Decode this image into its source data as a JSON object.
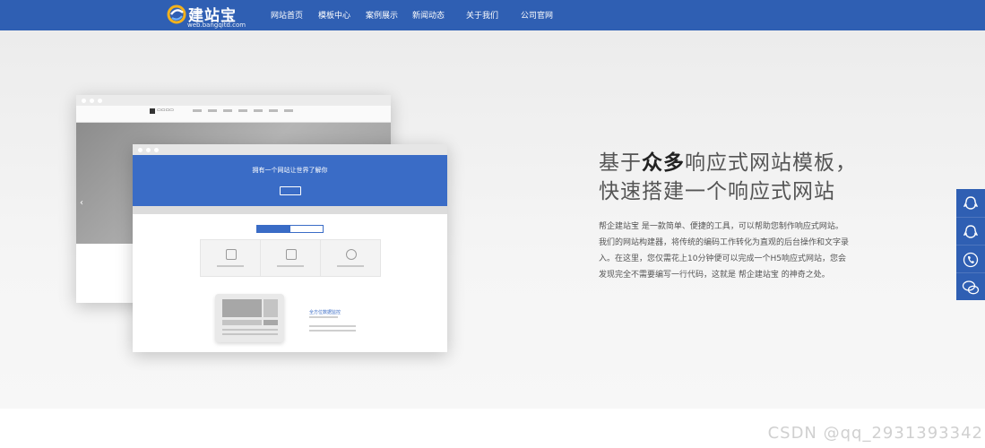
{
  "header": {
    "logo_title": "建站宝",
    "logo_subtitle": "web.bangqitd.com",
    "nav": [
      {
        "label": "网站首页"
      },
      {
        "label": "模板中心"
      },
      {
        "label": "案例展示"
      },
      {
        "label": "新闻动态"
      },
      {
        "label": "关于我们"
      },
      {
        "label": "公司官网"
      }
    ]
  },
  "hero": {
    "headline_line1_pre": "基于",
    "headline_line1_bold": "众多",
    "headline_line1_post": "响应式网站模板，",
    "headline_line2": "快速搭建一个响应式网站",
    "description_lines": [
      "帮企建站宝 是一款简单、便捷的工具，可以帮助您制作响应式网站。",
      "我们的网站构建器，将传统的编码工作转化为直观的后台操作和文字录",
      "入。在这里，您仅需花上10分钟便可以完成一个H5响应式网站，您会",
      "发现完全不需要编写一行代码，这就是 帮企建站宝 的神奇之处。"
    ]
  },
  "mockup": {
    "front_title": "拥有一个网站让世界了解你",
    "feature_title": "全方位数据监控"
  },
  "side_toolbar": {
    "icons": [
      "qq-icon",
      "qq-icon",
      "phone-icon",
      "wechat-icon"
    ]
  },
  "watermark": "CSDN @qq_2931393342",
  "colors": {
    "brand": "#2f5fb3",
    "accent": "#3a6cc6"
  }
}
